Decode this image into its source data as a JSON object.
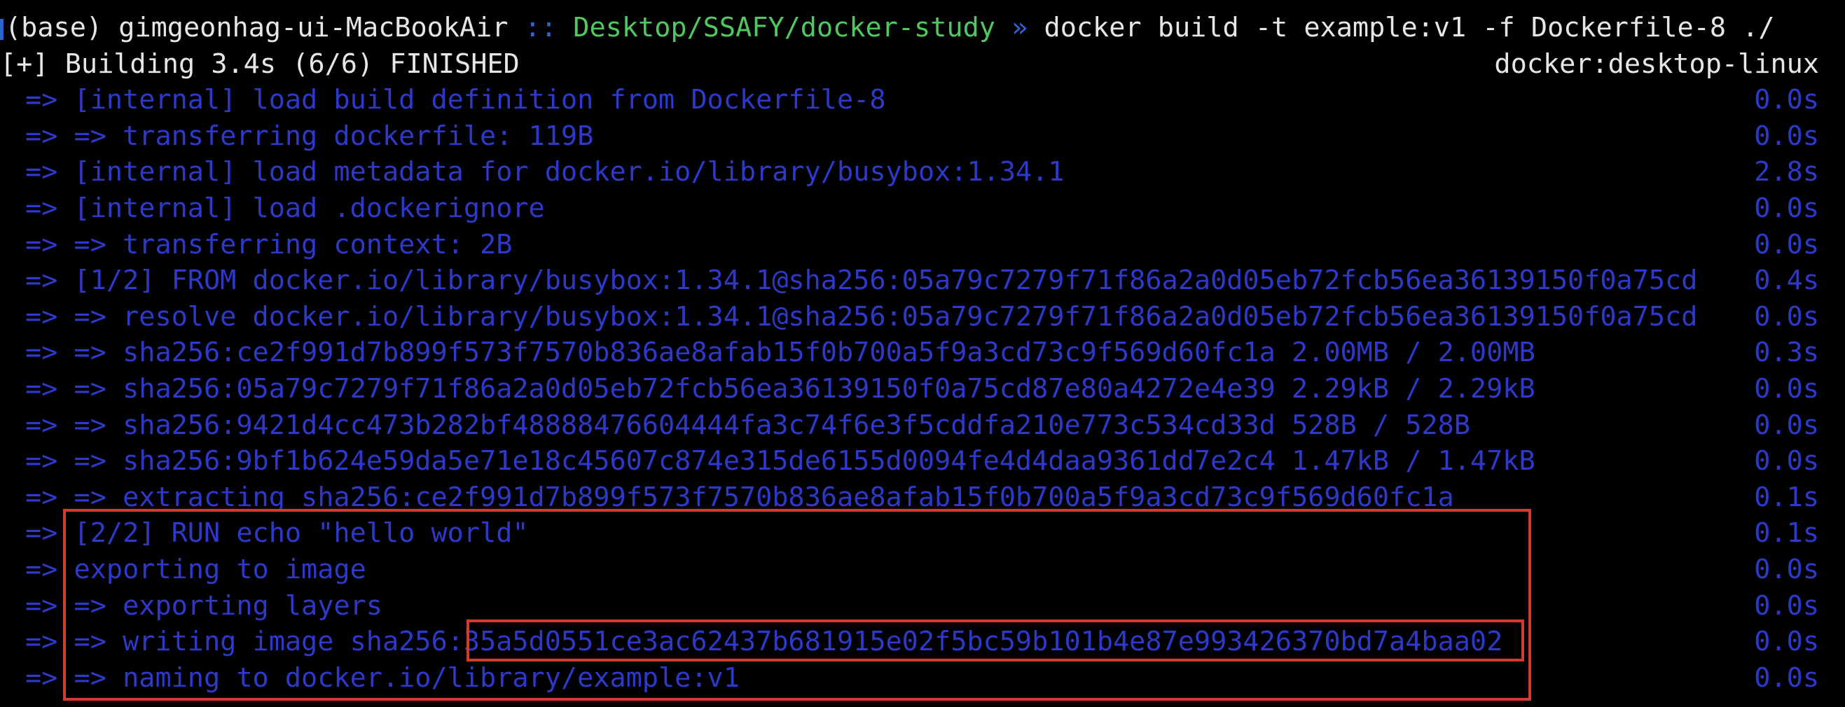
{
  "prompt": {
    "env": "(base)",
    "host": "gimgeonhag-ui-MacBookAir",
    "separator1": "::",
    "cwd": "Desktop/SSAFY/docker-study",
    "separator2": "»",
    "command": "docker build -t example:v1 -f Dockerfile-8 ./"
  },
  "status": {
    "text": "[+] Building 3.4s (6/6) FINISHED",
    "context": "docker:desktop-linux"
  },
  "steps": [
    {
      "prefix": "=>",
      "text": "[internal] load build definition from Dockerfile-8",
      "time": "0.0s"
    },
    {
      "prefix": "=>",
      "text": "=> transferring dockerfile: 119B",
      "time": "0.0s"
    },
    {
      "prefix": "=>",
      "text": "[internal] load metadata for docker.io/library/busybox:1.34.1",
      "time": "2.8s"
    },
    {
      "prefix": "=>",
      "text": "[internal] load .dockerignore",
      "time": "0.0s"
    },
    {
      "prefix": "=>",
      "text": "=> transferring context: 2B",
      "time": "0.0s"
    },
    {
      "prefix": "=>",
      "text": "[1/2] FROM docker.io/library/busybox:1.34.1@sha256:05a79c7279f71f86a2a0d05eb72fcb56ea36139150f0a75cd",
      "time": "0.4s"
    },
    {
      "prefix": "=>",
      "text": "=> resolve docker.io/library/busybox:1.34.1@sha256:05a79c7279f71f86a2a0d05eb72fcb56ea36139150f0a75cd",
      "time": "0.0s"
    },
    {
      "prefix": "=>",
      "text": "=> sha256:ce2f991d7b899f573f7570b836ae8afab15f0b700a5f9a3cd73c9f569d60fc1a 2.00MB / 2.00MB",
      "time": "0.3s"
    },
    {
      "prefix": "=>",
      "text": "=> sha256:05a79c7279f71f86a2a0d05eb72fcb56ea36139150f0a75cd87e80a4272e4e39 2.29kB / 2.29kB",
      "time": "0.0s"
    },
    {
      "prefix": "=>",
      "text": "=> sha256:9421d4cc473b282bf48888476604444fa3c74f6e3f5cddfa210e773c534cd33d 528B / 528B",
      "time": "0.0s"
    },
    {
      "prefix": "=>",
      "text": "=> sha256:9bf1b624e59da5e71e18c45607c874e315de6155d0094fe4d4daa9361dd7e2c4 1.47kB / 1.47kB",
      "time": "0.0s"
    },
    {
      "prefix": "=>",
      "text": "=> extracting sha256:ce2f991d7b899f573f7570b836ae8afab15f0b700a5f9a3cd73c9f569d60fc1a",
      "time": "0.1s"
    },
    {
      "prefix": "=>",
      "text": "[2/2] RUN echo \"hello world\"",
      "time": "0.1s"
    },
    {
      "prefix": "=>",
      "text": "exporting to image",
      "time": "0.0s"
    },
    {
      "prefix": "=>",
      "text": "=> exporting layers",
      "time": "0.0s"
    },
    {
      "prefix": "=>",
      "text": "=> writing image sha256:35a5d0551ce3ac62437b681915e02f5bc59b101b4e87e993426370bd7a4baa02",
      "time": "0.0s"
    },
    {
      "prefix": "=>",
      "text": "=> naming to docker.io/library/example:v1",
      "time": "0.0s"
    }
  ],
  "colors": {
    "background": "#000000",
    "prompt_text": "#e6e6e6",
    "cwd": "#4fc95f",
    "build_steps": "#2f39c9",
    "highlight_border": "#d43b2f"
  }
}
